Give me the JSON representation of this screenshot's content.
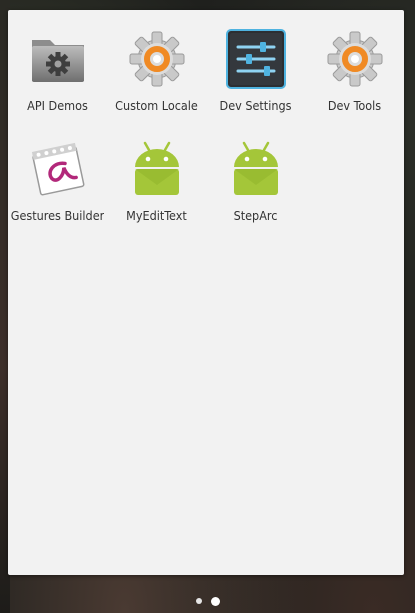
{
  "apps": [
    {
      "label": "API Demos",
      "icon": "folder-gear-icon"
    },
    {
      "label": "Custom Locale",
      "icon": "gear-orange-icon"
    },
    {
      "label": "Dev Settings",
      "icon": "sliders-icon"
    },
    {
      "label": "Dev Tools",
      "icon": "gear-orange-icon"
    },
    {
      "label": "Gestures Builder",
      "icon": "gestures-icon"
    },
    {
      "label": "MyEditText",
      "icon": "android-icon"
    },
    {
      "label": "StepArc",
      "icon": "android-icon"
    }
  ],
  "page_indicator": {
    "pages": 2,
    "current": 2
  },
  "colors": {
    "android_green": "#a4c639",
    "accent_orange": "#f08a24",
    "drawer_bg": "#f2f2f2"
  }
}
